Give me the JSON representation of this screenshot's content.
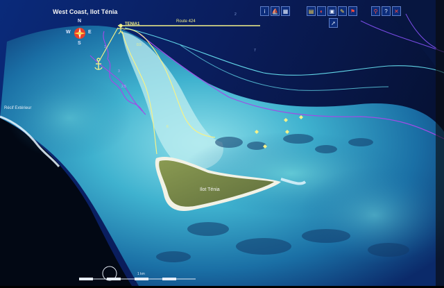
{
  "map": {
    "title": "West Coast, Ilot Ténia",
    "place_labels": {
      "island": "Ilot Ténia",
      "reef": "Récif Extérieur"
    },
    "waypoint_label": "TENIA1",
    "route_label": "Route 424",
    "depth_labels": [
      "0.5",
      "6",
      "3",
      "2.5",
      "1",
      "7",
      "2"
    ],
    "compass": {
      "n": "N",
      "s": "S",
      "e": "E",
      "w": "W"
    },
    "scale_label": "1 km"
  },
  "toolbar": {
    "left_group": [
      {
        "name": "info-icon",
        "glyph": "i"
      },
      {
        "name": "boat-icon",
        "glyph": "⛵"
      },
      {
        "name": "layers-icon",
        "glyph": "▦"
      }
    ],
    "middle_group": [
      {
        "name": "chart-icon",
        "glyph": "▤"
      },
      {
        "name": "palette-icon",
        "glyph": "◐"
      },
      {
        "name": "photo-icon",
        "glyph": "▣"
      },
      {
        "name": "tools-icon",
        "glyph": "✎"
      },
      {
        "name": "flag-icon",
        "glyph": "⚑"
      }
    ],
    "right_group": [
      {
        "name": "pin-icon",
        "glyph": "⚲"
      },
      {
        "name": "help-icon",
        "glyph": "?"
      },
      {
        "name": "close-icon",
        "glyph": "✕"
      }
    ]
  },
  "colors": {
    "route": "#f4f28a",
    "depth_contour": "#a04ce6",
    "shoal_contour": "#62d6e8",
    "land": "#7a8a4a",
    "deep_water": "#06163a"
  }
}
